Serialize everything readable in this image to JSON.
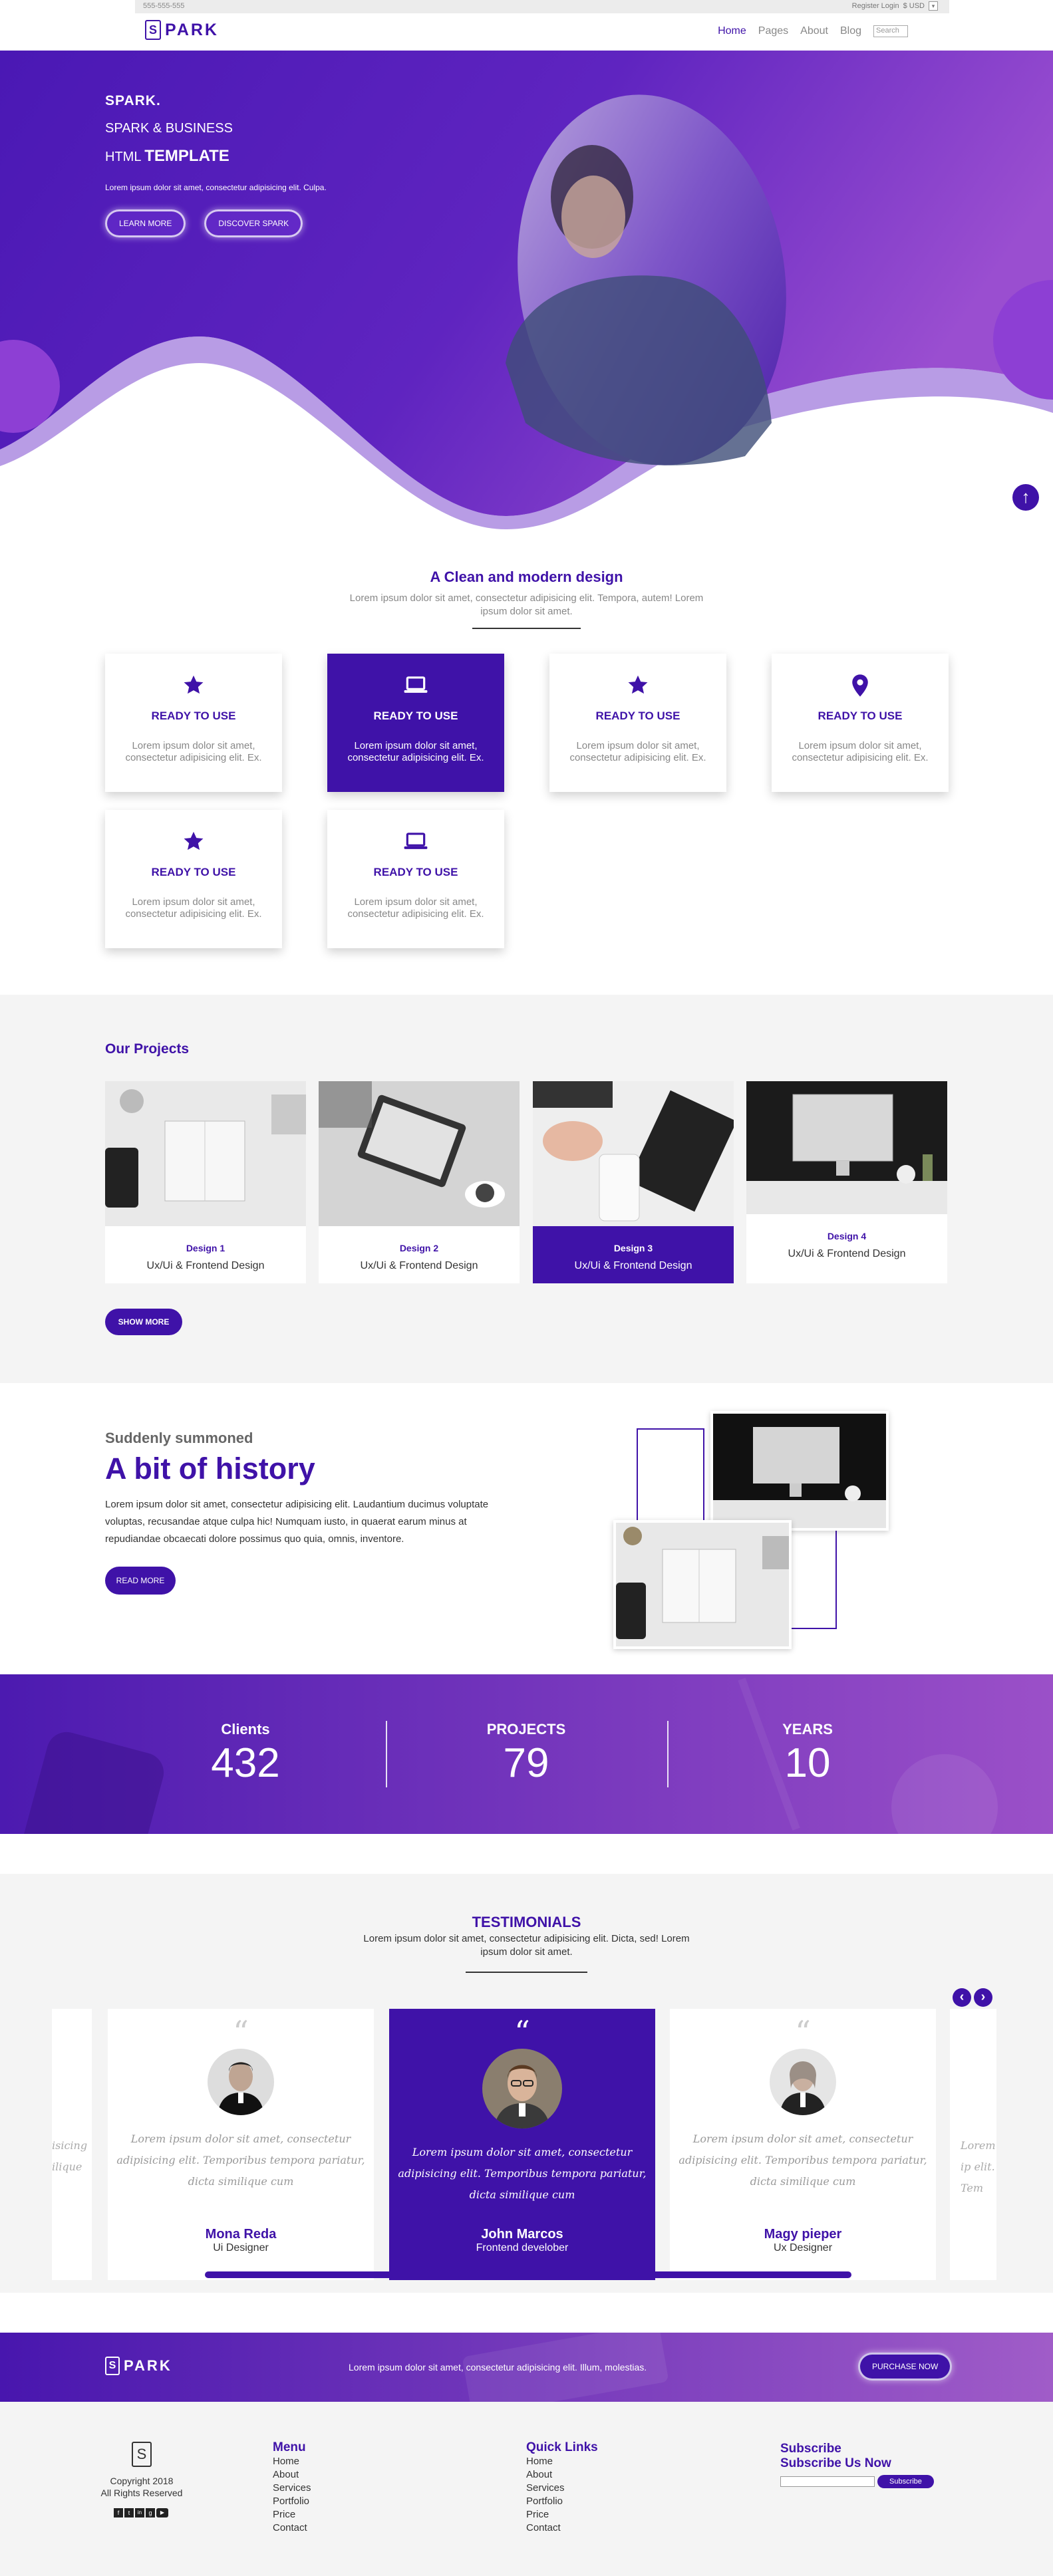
{
  "topbar": {
    "phone": "555-555-555",
    "links": "Register Login",
    "currency": "$ USD",
    "dropdown_glyph": "▾"
  },
  "brand": {
    "logo_letter": "S",
    "name": "PARK"
  },
  "nav": {
    "items": [
      "Home",
      "Pages",
      "About",
      "Blog"
    ],
    "search_placeholder": "Search"
  },
  "hero": {
    "line1": "SPARK.",
    "line2": "SPARK & BUSINESS",
    "line3_prefix": "HTML",
    "line3_bold": "TEMPLATE",
    "tagline": "Lorem ipsum dolor sit amet, consectetur adipisicing elit. Culpa.",
    "btn_learn": "LEARN MORE",
    "btn_discover": "DISCOVER SPARK",
    "scroll_glyph": "↑"
  },
  "features": {
    "title": "A Clean and modern design",
    "subtitle": "Lorem ipsum dolor sit amet, consectetur adipisicing elit. Tempora, autem! Lorem ipsum dolor sit amet.",
    "cards": [
      {
        "icon": "star-icon",
        "title": "READY TO USE",
        "desc": "Lorem ipsum dolor sit amet, consectetur adipisicing elit. Ex."
      },
      {
        "icon": "laptop-icon",
        "title": "READY TO USE",
        "desc": "Lorem ipsum dolor sit amet, consectetur adipisicing elit. Ex."
      },
      {
        "icon": "star-icon",
        "title": "READY TO USE",
        "desc": "Lorem ipsum dolor sit amet, consectetur adipisicing elit. Ex."
      },
      {
        "icon": "map-pin-icon",
        "title": "READY TO USE",
        "desc": "Lorem ipsum dolor sit amet, consectetur adipisicing elit. Ex."
      },
      {
        "icon": "star-icon",
        "title": "READY TO USE",
        "desc": "Lorem ipsum dolor sit amet, consectetur adipisicing elit. Ex."
      },
      {
        "icon": "laptop-icon",
        "title": "READY TO USE",
        "desc": "Lorem ipsum dolor sit amet, consectetur adipisicing elit. Ex."
      }
    ]
  },
  "projects": {
    "title": "Our Projects",
    "items": [
      {
        "name": "Design 1",
        "desc": "Ux/Ui & Frontend Design"
      },
      {
        "name": "Design 2",
        "desc": "Ux/Ui & Frontend Design"
      },
      {
        "name": "Design 3",
        "desc": "Ux/Ui & Frontend Design"
      },
      {
        "name": "Design 4",
        "desc": "Ux/Ui & Frontend Design"
      }
    ],
    "show_more": "SHOW MORE"
  },
  "history": {
    "kicker": "Suddenly summoned",
    "title": "A bit of history",
    "body": "Lorem ipsum dolor sit amet, consectetur adipisicing elit. Laudantium ducimus voluptate voluptas, recusandae atque culpa hic! Numquam iusto, in quaerat earum minus at repudiandae obcaecati dolore possimus quo quia, omnis, inventore.",
    "read_more": "READ MORE"
  },
  "stats": [
    {
      "label": "Clients",
      "value": "432"
    },
    {
      "label": "PROJECTS",
      "value": "79"
    },
    {
      "label": "YEARS",
      "value": "10"
    }
  ],
  "testimonials": {
    "title": "TESTIMONIALS",
    "subtitle": "Lorem ipsum dolor sit amet, consectetur adipisicing elit. Dicta, sed! Lorem ipsum dolor sit amet.",
    "quote_glyph": "“",
    "prev_glyph": "‹",
    "next_glyph": "›",
    "text": "Lorem ipsum dolor sit amet, consectetur adipisicing elit. Temporibus tempora pariatur, dicta similique cum",
    "side_left": "isicing ilique",
    "side_right": "Lorem ip elit. Tem",
    "people": [
      {
        "name": "Mona Reda",
        "role": "Ui Designer"
      },
      {
        "name": "John Marcos",
        "role": "Frontend develober"
      },
      {
        "name": "Magy pieper",
        "role": "Ux Designer"
      }
    ]
  },
  "cta": {
    "text": "Lorem ipsum dolor sit amet, consectetur adipisicing elit. Illum, molestias.",
    "button": "PURCHASE NOW"
  },
  "footer": {
    "copyright": "Copyright 2018",
    "rights": "All Rights Reserved",
    "social_glyphs": [
      "f",
      "t",
      "in",
      "g",
      "▶"
    ],
    "menu_title": "Menu",
    "menu": [
      "Home",
      "About",
      "Services",
      "Portfolio",
      "Price",
      "Contact"
    ],
    "links_title": "Quick Links",
    "links": [
      "Home",
      "About",
      "Services",
      "Portfolio",
      "Price",
      "Contact"
    ],
    "sub_title": "Subscribe",
    "sub_sub": "Subscribe Us Now",
    "sub_btn": "Subscribe"
  },
  "colors": {
    "brand": "#3f12a8",
    "accent": "#8b3fc2",
    "light_bg": "#f4f4f4"
  }
}
